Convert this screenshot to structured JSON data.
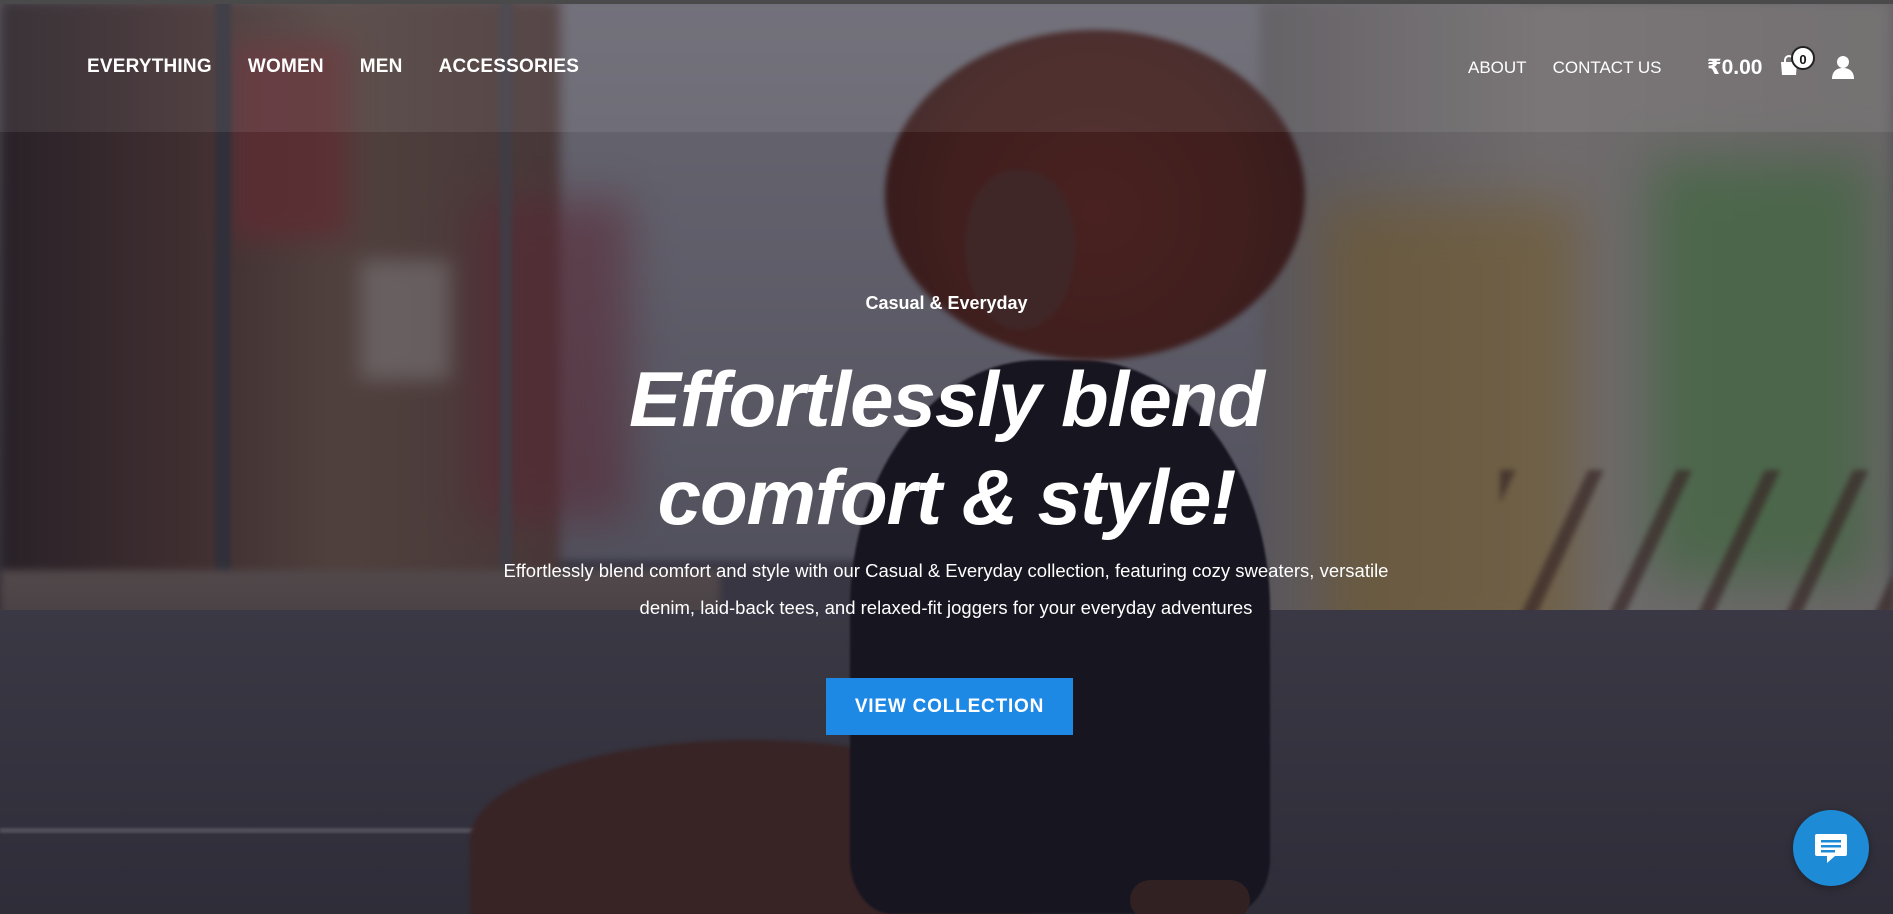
{
  "nav": {
    "left_items": [
      {
        "label": "EVERYTHING"
      },
      {
        "label": "WOMEN"
      },
      {
        "label": "MEN"
      },
      {
        "label": "ACCESSORIES"
      }
    ],
    "right_items": [
      {
        "label": "ABOUT"
      },
      {
        "label": "CONTACT US"
      }
    ],
    "cart": {
      "total": "₹0.00",
      "count": "0",
      "icon": "shopping-bag-icon"
    },
    "account": {
      "icon": "user-icon"
    }
  },
  "hero": {
    "eyebrow": "Casual & Everyday",
    "headline_line1": "Effortlessly blend",
    "headline_line2": "comfort & style!",
    "description": "Effortlessly blend comfort and style with our Casual & Everyday collection, featuring cozy sweaters, versatile denim, laid-back tees, and relaxed-fit joggers for your everyday adventures",
    "cta_label": "VIEW COLLECTION"
  },
  "chat": {
    "icon": "chat-bubble-icon"
  },
  "colors": {
    "accent": "#1e88e5",
    "chat": "#1e8bd6",
    "overlay": "#161424"
  }
}
